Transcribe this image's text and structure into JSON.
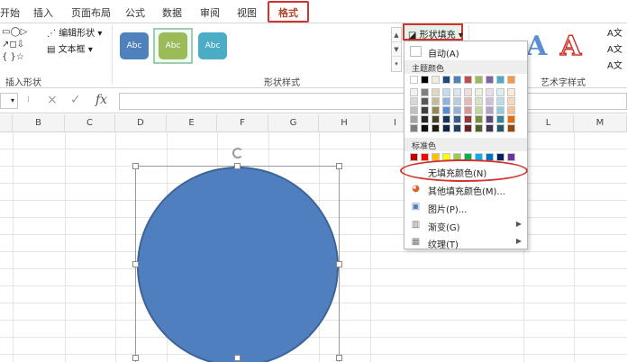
{
  "tabs": [
    {
      "label": "开始"
    },
    {
      "label": "插入"
    },
    {
      "label": "页面布局"
    },
    {
      "label": "公式"
    },
    {
      "label": "数据"
    },
    {
      "label": "审阅"
    },
    {
      "label": "视图"
    },
    {
      "label": "格式"
    }
  ],
  "ribbon": {
    "insert_shapes_label": "插入形状",
    "edit_shape_label": "编辑形状",
    "textbox_label": "文本框",
    "shape_styles_label": "形状样式",
    "wordart_label": "艺术字样式",
    "shape_fill_label": "形状填充",
    "style_text": "Abc",
    "styles": [
      {
        "color": "#000000"
      },
      {
        "color": "#4f81bd"
      },
      {
        "color": "#c0504d"
      },
      {
        "color": "#9bbb59"
      },
      {
        "color": "#8064a2"
      },
      {
        "color": "#4bacc6"
      },
      {
        "color": "#f79646"
      }
    ],
    "wordart_right_text": [
      "文",
      "文",
      "文"
    ]
  },
  "formula_bar": {
    "fx_label": "fx",
    "cancel_icon": "×",
    "enter_icon": "✓"
  },
  "columns": [
    "B",
    "C",
    "D",
    "E",
    "F",
    "G",
    "H",
    "I",
    "L",
    "M"
  ],
  "dropdown": {
    "auto_label": "自动(A)",
    "theme_colors_label": "主题颜色",
    "standard_colors_label": "标准色",
    "no_fill_label": "无填充颜色(N)",
    "more_fill_label": "其他填充颜色(M)...",
    "picture_label": "图片(P)...",
    "gradient_label": "渐变(G)",
    "texture_label": "纹理(T)",
    "theme_top": [
      "#ffffff",
      "#000000",
      "#eeece1",
      "#1f497d",
      "#4f81bd",
      "#c0504d",
      "#9bbb59",
      "#8064a2",
      "#4bacc6",
      "#f79646"
    ],
    "theme_shades": [
      [
        "#f2f2f2",
        "#7f7f7f",
        "#ddd9c3",
        "#c6d9f0",
        "#dbe5f1",
        "#f2dcdb",
        "#ebf1dd",
        "#e5e0ec",
        "#dbeef3",
        "#fdeada"
      ],
      [
        "#d8d8d8",
        "#595959",
        "#c4bd97",
        "#8db3e2",
        "#b8cce4",
        "#e5b9b7",
        "#d7e3bc",
        "#ccc1d9",
        "#b7dde8",
        "#fbd5b5"
      ],
      [
        "#bfbfbf",
        "#3f3f3f",
        "#938953",
        "#548dd4",
        "#95b3d7",
        "#d99694",
        "#c3d69b",
        "#b2a2c7",
        "#92cddc",
        "#fac08f"
      ],
      [
        "#a5a5a5",
        "#262626",
        "#494429",
        "#17365d",
        "#366092",
        "#953734",
        "#76923c",
        "#5f497a",
        "#31859b",
        "#e36c09"
      ],
      [
        "#7f7f7f",
        "#0c0c0c",
        "#1d1b10",
        "#0f243e",
        "#244061",
        "#632423",
        "#4f6128",
        "#3f3151",
        "#205867",
        "#974806"
      ]
    ],
    "standard": [
      "#c00000",
      "#ff0000",
      "#ffc000",
      "#ffff00",
      "#92d050",
      "#00b050",
      "#00b0f0",
      "#0070c0",
      "#002060",
      "#7030a0"
    ]
  },
  "shape": {
    "fill": "#4f7fbf",
    "outline": "#3d6496"
  }
}
